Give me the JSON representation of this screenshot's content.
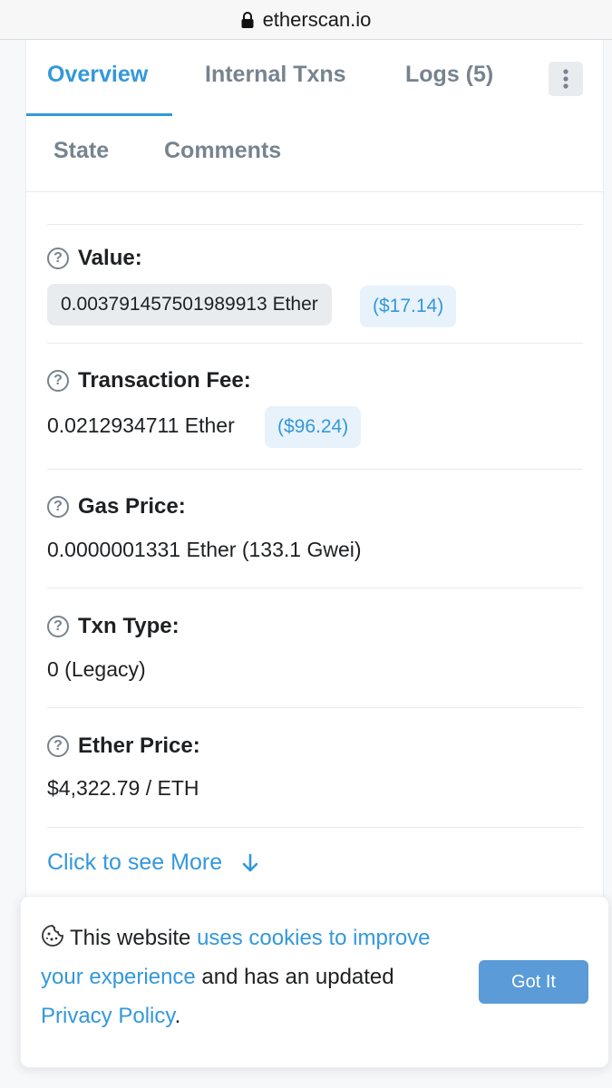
{
  "browser": {
    "url": "etherscan.io"
  },
  "tabs": {
    "overview": "Overview",
    "internal_txns": "Internal Txns",
    "logs": "Logs (5)",
    "state": "State",
    "comments": "Comments"
  },
  "fields": {
    "value": {
      "label": "Value:",
      "amount": "0.003791457501989913 Ether",
      "usd": "($17.14)"
    },
    "fee": {
      "label": "Transaction Fee:",
      "amount": "0.0212934711 Ether",
      "usd": "($96.24)"
    },
    "gas_price": {
      "label": "Gas Price:",
      "amount": "0.0000001331 Ether (133.1 Gwei)"
    },
    "txn_type": {
      "label": "Txn Type:",
      "amount": "0 (Legacy)"
    },
    "ether_price": {
      "label": "Ether Price:",
      "amount": "$4,322.79 / ETH"
    }
  },
  "see_more": "Click to see More",
  "cookie": {
    "text_1": "This website ",
    "link_1": "uses cookies to improve your experience",
    "text_2": " and has an updated ",
    "link_2": "Privacy Policy",
    "text_3": ".",
    "button": "Got It"
  },
  "colors": {
    "accent": "#3498db",
    "button": "#5a9bd8",
    "muted": "#77838f"
  }
}
